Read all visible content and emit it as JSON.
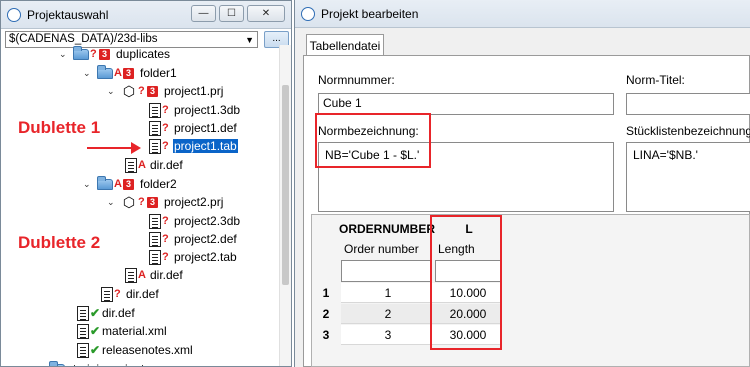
{
  "left_window": {
    "title": "Projektauswahl",
    "controls": {
      "minimize": "—",
      "maximize": "☐",
      "close": "✕"
    },
    "path": "$(CADENAS_DATA)/23d-libs",
    "browse_label": "...",
    "tree": [
      {
        "label": "duplicates",
        "status": "?",
        "badge": "3"
      },
      {
        "label": "folder1",
        "status": "A",
        "badge": "3"
      },
      {
        "label": "project1.prj",
        "status": "?",
        "badge": "3"
      },
      {
        "label": "project1.3db",
        "status": "?"
      },
      {
        "label": "project1.def",
        "status": "?"
      },
      {
        "label": "project1.tab",
        "status": "?"
      },
      {
        "label": "dir.def",
        "status": "A"
      },
      {
        "label": "folder2",
        "status": "A",
        "badge": "3"
      },
      {
        "label": "project2.prj",
        "status": "?",
        "badge": "3"
      },
      {
        "label": "project2.3db",
        "status": "?"
      },
      {
        "label": "project2.def",
        "status": "?"
      },
      {
        "label": "project2.tab",
        "status": "?"
      },
      {
        "label": "dir.def",
        "status": "A"
      },
      {
        "label": "dir.def",
        "status": "?"
      },
      {
        "label": "dir.def",
        "status": "✔"
      },
      {
        "label": "material.xml",
        "status": "✔"
      },
      {
        "label": "releasenotes.xml",
        "status": "✔"
      },
      {
        "label": "training_sip_tmp",
        "status": ""
      }
    ],
    "annotations": {
      "dup1": "Dublette 1",
      "dup2": "Dublette 2"
    }
  },
  "right_window": {
    "title": "Projekt bearbeiten",
    "tab": "Tabellendatei",
    "normnummer_label": "Normnummer:",
    "normnummer_value": "Cube 1",
    "normtitel_label": "Norm-Titel:",
    "normtitel_value": "",
    "normbezeichnung_label": "Normbezeichnung:",
    "normbezeichnung_value": "NB='Cube 1 - $L.'",
    "stueckliste_label": "Stücklistenbezeichnung:",
    "stueckliste_value": "LINA='$NB.'",
    "table": {
      "columns": [
        {
          "name": "ORDERNUMBER",
          "desc": "Order number"
        },
        {
          "name": "L",
          "desc": "Length"
        }
      ],
      "rows": [
        {
          "idx": "1",
          "order": "1",
          "length": "10.000"
        },
        {
          "idx": "2",
          "order": "2",
          "length": "20.000"
        },
        {
          "idx": "3",
          "order": "3",
          "length": "30.000"
        }
      ]
    }
  },
  "colors": {
    "annotation_red": "#e8252a",
    "selection_blue": "#0a64c8"
  }
}
